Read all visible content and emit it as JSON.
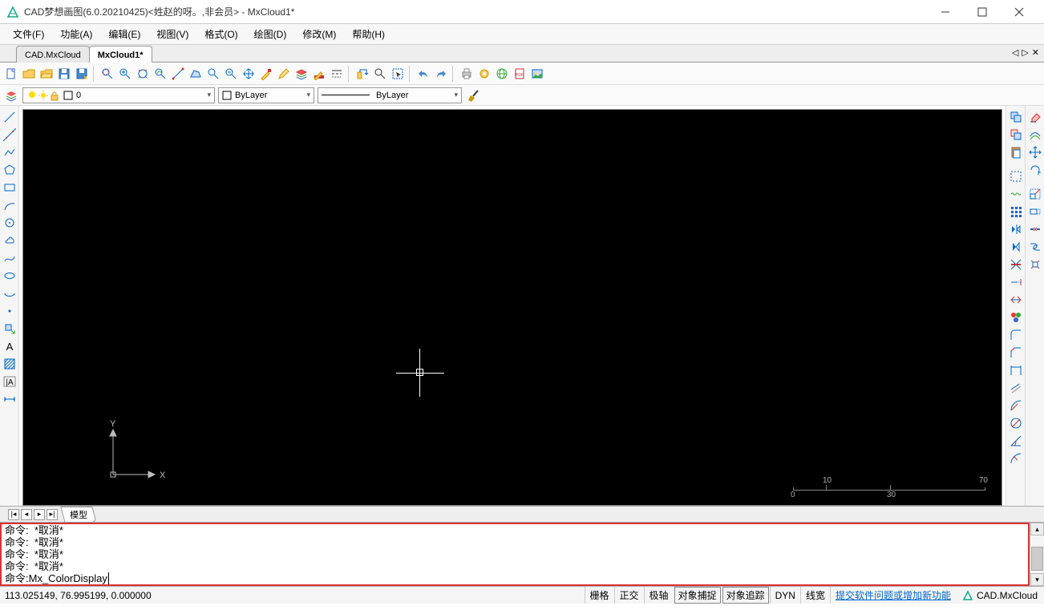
{
  "title": "CAD梦想画图(6.0.20210425)<姓赵的呀。,非会员> - MxCloud1*",
  "menu": {
    "file": "文件(F)",
    "func": "功能(A)",
    "edit": "编辑(E)",
    "view": "视图(V)",
    "format": "格式(O)",
    "draw": "绘图(D)",
    "modify": "修改(M)",
    "help": "帮助(H)"
  },
  "tabs": {
    "t1": "CAD.MxCloud",
    "t2": "MxCloud1*"
  },
  "layer": {
    "combo1": "0",
    "combo2": "ByLayer",
    "combo3": "ByLayer"
  },
  "modeltab": "模型",
  "cmdlog": {
    "l0": "命令:  *取消*",
    "l1": "命令:  *取消*",
    "l2": "命令:  *取消*",
    "l3": "命令:  *取消*",
    "prompt": "命令: ",
    "input": "Mx_ColorDisplay"
  },
  "status": {
    "coords": "113.025149,  76.995199,  0.000000",
    "grid": "栅格",
    "ortho": "正交",
    "polar": "极轴",
    "osnap": "对象捕捉",
    "otrack": "对象追踪",
    "dyn": "DYN",
    "lwt": "线宽",
    "link": "提交软件问题或增加新功能",
    "brand": "CAD.MxCloud"
  },
  "ucs": {
    "x": "X",
    "y": "Y"
  },
  "ruler": {
    "t1": "10",
    "t2": "70",
    "b1": "0",
    "b2": "30"
  }
}
